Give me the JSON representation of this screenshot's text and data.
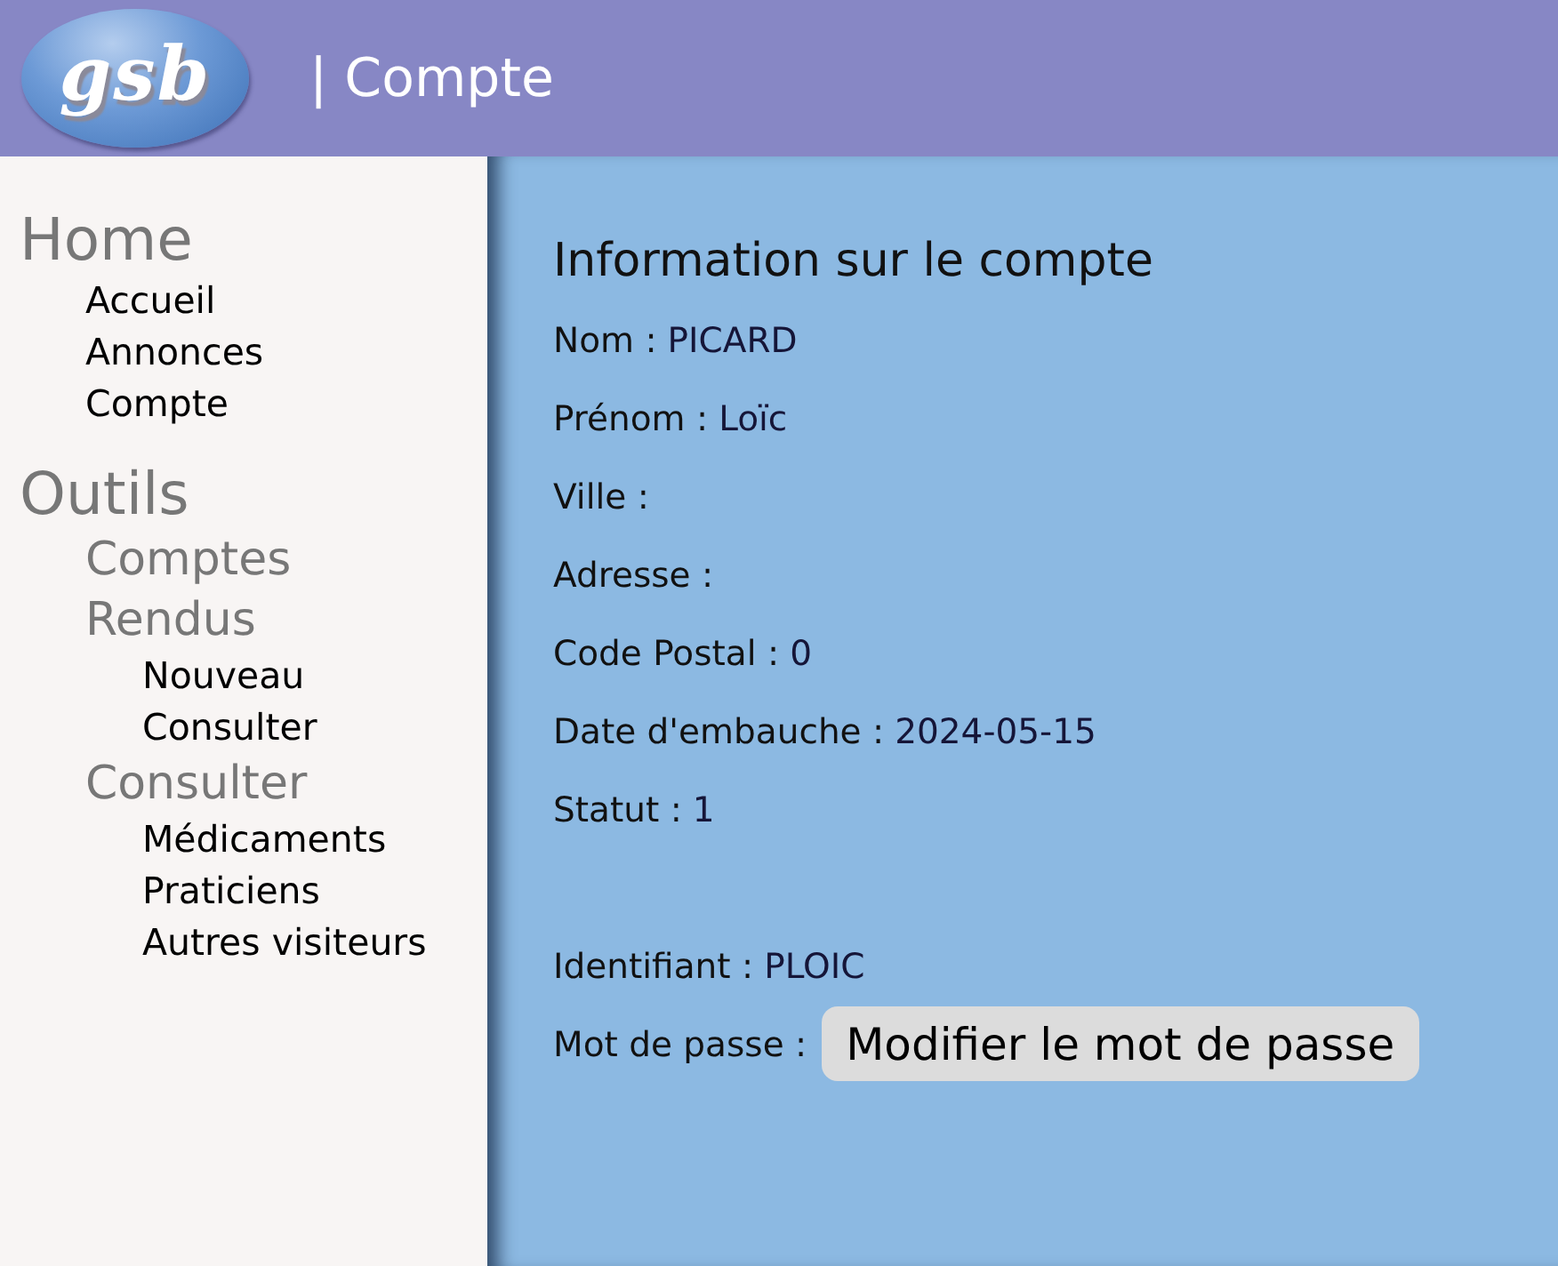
{
  "header": {
    "logo": "gsb",
    "title": "| Compte"
  },
  "sidebar": [
    {
      "label": "Home",
      "kind": "section",
      "children": [
        {
          "label": "Accueil",
          "kind": "link"
        },
        {
          "label": "Annonces",
          "kind": "link"
        },
        {
          "label": "Compte",
          "kind": "link"
        }
      ]
    },
    {
      "label": "Outils",
      "kind": "section",
      "children": [
        {
          "label": "Comptes",
          "kind": "category"
        },
        {
          "label": "Rendus",
          "kind": "category",
          "children": [
            {
              "label": "Nouveau",
              "kind": "link"
            },
            {
              "label": "Consulter",
              "kind": "link"
            }
          ]
        },
        {
          "label": "Consulter",
          "kind": "category",
          "children": [
            {
              "label": "Médicaments",
              "kind": "link"
            },
            {
              "label": "Praticiens",
              "kind": "link"
            },
            {
              "label": "Autres visiteurs",
              "kind": "link"
            }
          ]
        }
      ]
    }
  ],
  "account": {
    "title": "Information sur le compte",
    "fields": [
      {
        "label": "Nom :",
        "value": "PICARD"
      },
      {
        "label": "Prénom :",
        "value": "Loïc"
      },
      {
        "label": "Ville :"
      },
      {
        "label": "Adresse :"
      },
      {
        "label": "Code Postal :",
        "value": "0"
      },
      {
        "label": "Date d'embauche :",
        "value": "2024-05-15"
      },
      {
        "label": "Statut :",
        "value": "1"
      }
    ],
    "login": [
      {
        "label": "Identifiant :",
        "value": "PLOIC"
      }
    ],
    "password": {
      "label": "Mot de passe :",
      "button": "Modifier le mot de passe"
    }
  }
}
